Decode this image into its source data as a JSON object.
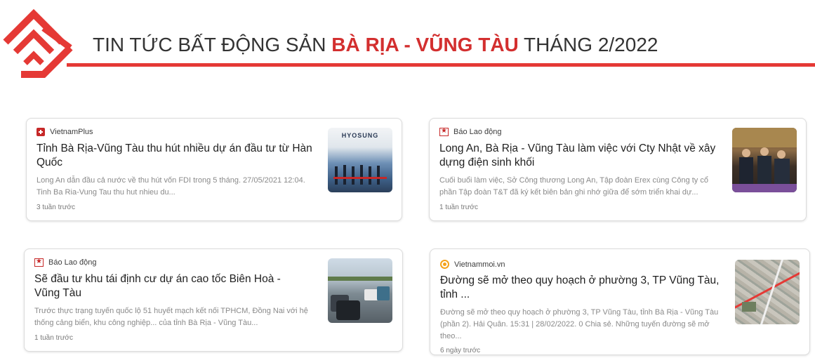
{
  "header": {
    "title_prefix": "TIN TỨC BẤT ĐỘNG SẢN ",
    "title_highlight": "BÀ RỊA - VŨNG TÀU",
    "title_suffix": " THÁNG 2/2022",
    "accent_color": "#e53935"
  },
  "cards": [
    {
      "source": "VietnamPlus",
      "source_icon": "vietnamplus-icon",
      "headline": "Tỉnh Bà Rịa-Vũng Tàu thu hút nhiều dự án đầu tư từ Hàn Quốc",
      "snippet": "Long An dẫn đầu cả nước về thu hút vốn FDI trong 5 tháng. 27/05/2021 12:04. Tinh Ba Ria-Vung Tau thu hut nhieu du...",
      "time": "3 tuần trước",
      "thumb_text": "HYOSUNG"
    },
    {
      "source": "Báo Lao động",
      "source_icon": "bao-lao-dong-icon",
      "headline": "Long An, Bà Rịa - Vũng Tàu làm việc với Cty Nhật về xây dựng điện sinh khối",
      "snippet": "Cuối buổi làm việc, Sở Công thương Long An, Tập đoàn Erex cùng Công ty cổ phần Tập đoàn T&T đã ký kết biên bản ghi nhớ giữa để sớm triển khai dự...",
      "time": "1 tuần trước"
    },
    {
      "source": "Báo Lao động",
      "source_icon": "bao-lao-dong-icon",
      "headline": "Sẽ đầu tư khu tái định cư dự án cao tốc Biên Hoà - Vũng Tàu",
      "snippet": "Trước thực trạng tuyến quốc lộ 51 huyết mạch kết nối TPHCM, Đồng Nai với hệ thống cảng biển, khu công nghiệp... của tỉnh Bà Rịa - Vũng Tàu...",
      "time": "1 tuần trước"
    },
    {
      "source": "Vietnammoi.vn",
      "source_icon": "vietnammoi-icon",
      "headline": "Đường sẽ mở theo quy hoạch ở phường 3, TP Vũng Tàu, tỉnh ...",
      "snippet": "Đường sẽ mở theo quy hoạch ở phường 3, TP Vũng Tàu, tỉnh Bà Rịa - Vũng Tàu (phần 2). Hải Quân. 15:31 | 28/02/2022. 0 Chia sẻ. Những tuyến đường sẽ mở theo...",
      "time": "6 ngày trước"
    }
  ]
}
